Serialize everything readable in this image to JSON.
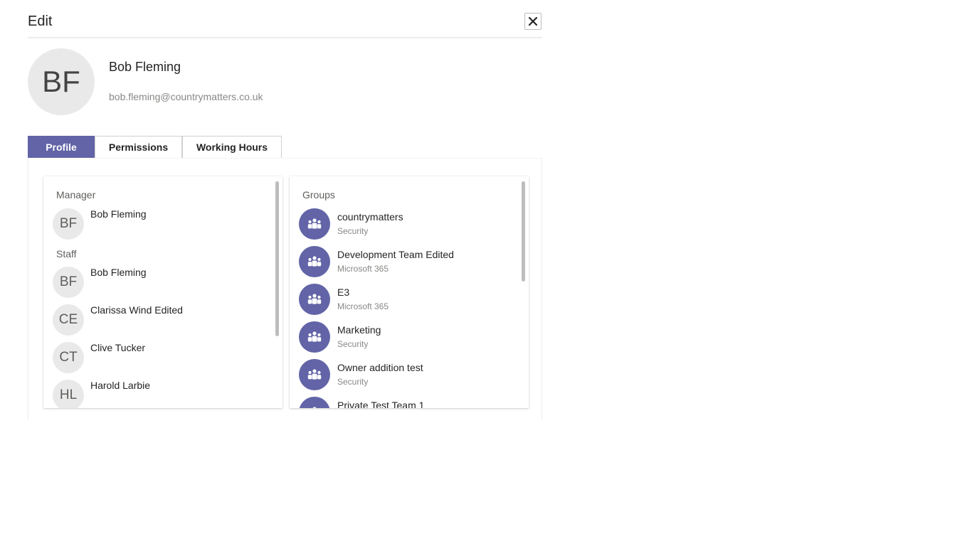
{
  "dialog": {
    "title": "Edit",
    "close_icon": "close-icon"
  },
  "user": {
    "initials": "BF",
    "name": "Bob Fleming",
    "email": "bob.fleming@countrymatters.co.uk"
  },
  "tabs": [
    {
      "label": "Profile",
      "active": true
    },
    {
      "label": "Permissions",
      "active": false
    },
    {
      "label": "Working Hours",
      "active": false
    }
  ],
  "people": {
    "manager_label": "Manager",
    "manager": {
      "initials": "BF",
      "name": "Bob Fleming"
    },
    "staff_label": "Staff",
    "staff": [
      {
        "initials": "BF",
        "name": "Bob Fleming"
      },
      {
        "initials": "CE",
        "name": "Clarissa Wind Edited"
      },
      {
        "initials": "CT",
        "name": "Clive Tucker"
      },
      {
        "initials": "HL",
        "name": "Harold Larbie"
      }
    ]
  },
  "groups": {
    "label": "Groups",
    "icon": "group-icon",
    "items": [
      {
        "name": "countrymatters",
        "type": "Security"
      },
      {
        "name": "Development Team Edited",
        "type": "Microsoft 365"
      },
      {
        "name": "E3",
        "type": "Microsoft 365"
      },
      {
        "name": "Marketing",
        "type": "Security"
      },
      {
        "name": "Owner addition test",
        "type": "Security"
      },
      {
        "name": "Private Test Team 1",
        "type": ""
      }
    ]
  },
  "colors": {
    "accent": "#6264a7",
    "avatar_bg": "#e9e9e9",
    "muted_text": "#8a8886"
  }
}
